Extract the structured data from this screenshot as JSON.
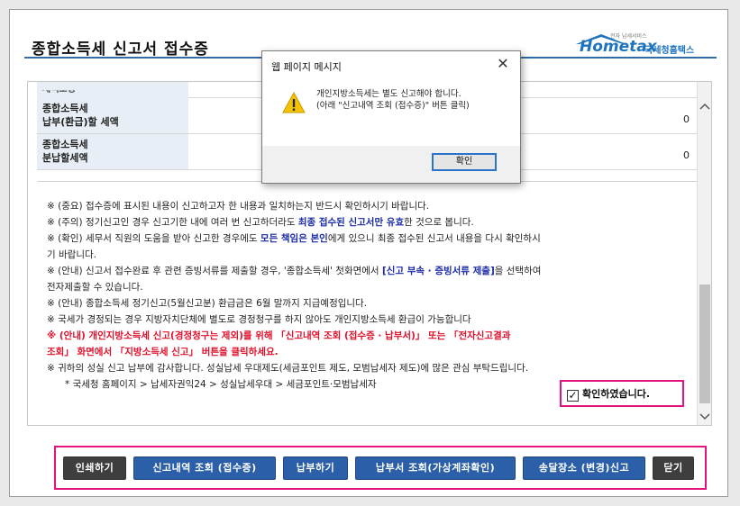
{
  "header": {
    "title": "종합소득세 신고서 접수증",
    "logo_text": "Hometax",
    "logo_sub": "국세청홈택스",
    "logo_tiny": "전자 납세서비스"
  },
  "table": {
    "partial_row_label": "세액조정",
    "rows": [
      {
        "label_line1": "종합소득세",
        "label_line2": "납부(환급)할 세액",
        "value": "0"
      },
      {
        "label_line1": "종합소득세",
        "label_line2": "분납할세액",
        "value": "0"
      }
    ]
  },
  "notices": {
    "n1": "※ (중요) 접수증에 표시된 내용이 신고하고자 한 내용과 일치하는지 반드시 확인하시기 바랍니다.",
    "n2_a": "※ (주의) 정기신고인 경우 신고기한 내에 여러 번 신고하더라도 ",
    "n2_em": "최종 접수된 신고서만 유효",
    "n2_b": "한 것으로 봅니다.",
    "n3_a": "※ (확인) 세무서 직원의 도움을 받아 신고한 경우에도 ",
    "n3_em": "모든 책임은 본인",
    "n3_b": "에게 있으니 최종 접수된 신고서 내용을 다시 확인하시",
    "n3_c": "기 바랍니다.",
    "n4_a": "※ (안내) 신고서 접수완료 후 관련 증빙서류를 제출할 경우, '종합소득세' 첫화면에서 ",
    "n4_em": "[신고 부속 · 증빙서류 제출]",
    "n4_b": "을 선택하여",
    "n4_c": "전자제출할 수 있습니다.",
    "n5": "※ (안내) 종합소득세 정기신고(5월신고분) 환급금은 6월 말까지 지급예정입니다.",
    "n6": "※ 국세가 경정되는 경우 지방자치단체에 별도로 경정청구를 하지 않아도 개인지방소득세 환급이 가능합니다",
    "n7_a": "※ (안내) 개인지방소득세 신고(경정청구는 제외)를 위해 「신고내역 조회 (접수증 · 납부서)」 또는 「전자신고결과",
    "n7_b": "조회」 화면에서 「지방소득세 신고」 버튼을 클릭하세요.",
    "n8": "※ 귀하의 성실 신고 납부에 감사합니다. 성실납세 우대제도(세금포인트 제도, 모범납세자 제도)에 많은 관심 부탁드립니다.",
    "n9": "* 국세청 홈페이지 > 납세자권익24 > 성실납세우대 > 세금포인트·모범납세자"
  },
  "confirm": {
    "label": "확인하였습니다.",
    "checked": true,
    "check_glyph": "✓"
  },
  "buttons": {
    "print": "인쇄하기",
    "history": "신고내역 조회 (접수증)",
    "pay": "납부하기",
    "bill": "납부서 조회(가상계좌확인)",
    "address": "송달장소 (변경)신고",
    "close": "닫기"
  },
  "dialog": {
    "title": "웹 페이지 메시지",
    "close_glyph": "✕",
    "line1": "개인지방소득세는 별도 신고해야 합니다.",
    "line2": "(아래 \"신고내역 조회 (접수증)\" 버튼 클릭)",
    "ok": "확인",
    "icon": "warning-icon"
  },
  "colors": {
    "accent_pink": "#e3147e",
    "button_blue": "#2b5fa8",
    "button_dark": "#3e3e3e",
    "emphasis_blue": "#1a2aa8",
    "emphasis_red": "#e0102a",
    "header_line": "#2d6ea8"
  }
}
